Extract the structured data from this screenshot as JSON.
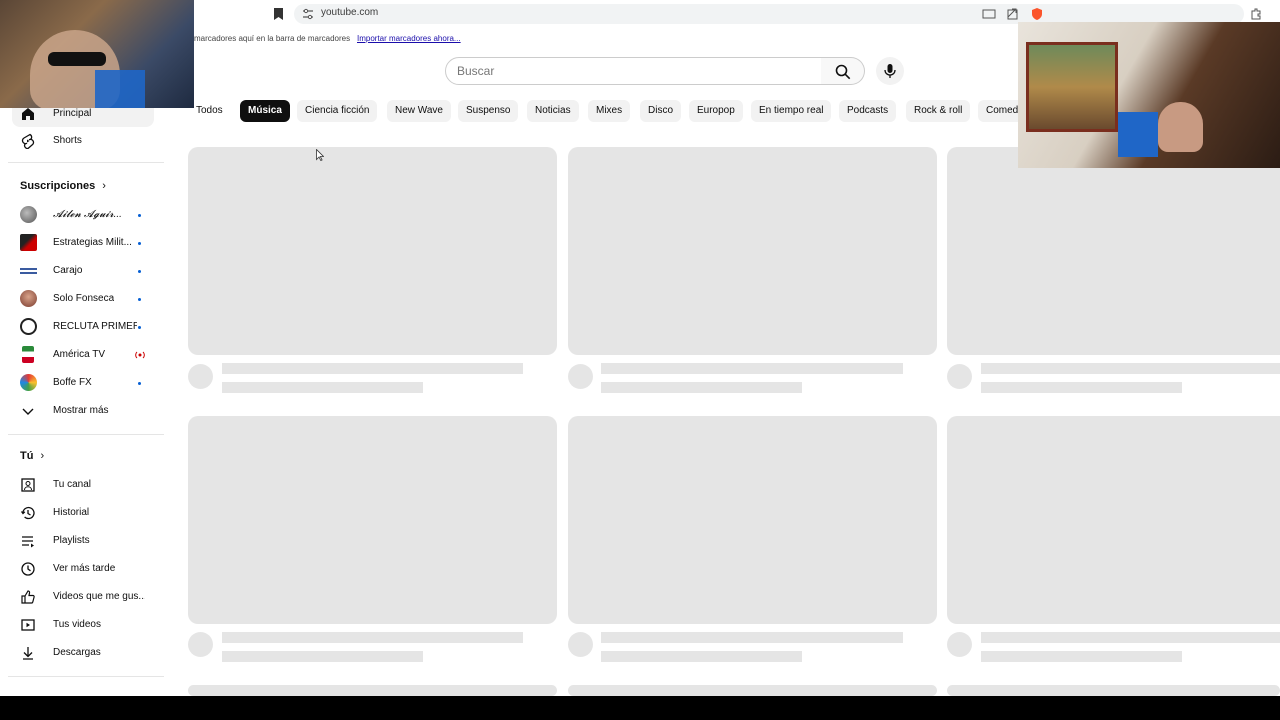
{
  "browser": {
    "url": "youtube.com",
    "bookmarks_hint": "marcadores aquí en la barra de marcadores",
    "import_link": "Importar marcadores ahora..."
  },
  "header": {
    "search_placeholder": "Buscar"
  },
  "chips": [
    "Todos",
    "Música",
    "Ciencia ficción",
    "New Wave",
    "Suspenso",
    "Noticias",
    "Mixes",
    "Disco",
    "Europop",
    "En tiempo real",
    "Podcasts",
    "Rock & roll",
    "Comed"
  ],
  "active_chip": "Música",
  "sidebar": {
    "main": [
      {
        "label": "Principal",
        "icon": "home-icon"
      },
      {
        "label": "Shorts",
        "icon": "shorts-icon"
      }
    ],
    "subscriptions_title": "Suscripciones",
    "subscriptions": [
      {
        "label": "𝓐𝓲𝓵𝓮𝓷 𝓐𝓰𝓾𝓲𝓻...",
        "status": "new"
      },
      {
        "label": "Estrategias Milit...",
        "status": "new"
      },
      {
        "label": "Carajo",
        "status": "new"
      },
      {
        "label": "Solo Fonseca",
        "status": "new"
      },
      {
        "label": "RECLUTA PRIMER",
        "status": "new"
      },
      {
        "label": "América TV",
        "status": "live"
      },
      {
        "label": "Boffe FX",
        "status": "new"
      }
    ],
    "show_more": "Mostrar más",
    "you_title": "Tú",
    "you": [
      {
        "label": "Tu canal",
        "icon": "channel-icon"
      },
      {
        "label": "Historial",
        "icon": "history-icon"
      },
      {
        "label": "Playlists",
        "icon": "playlist-icon"
      },
      {
        "label": "Ver más tarde",
        "icon": "clock-icon"
      },
      {
        "label": "Videos que me gus...",
        "icon": "thumbs-up-icon"
      },
      {
        "label": "Tus videos",
        "icon": "video-icon"
      },
      {
        "label": "Descargas",
        "icon": "download-icon"
      }
    ]
  },
  "colors": {
    "accent": "#0f0f0f",
    "skeleton": "#e5e5e5",
    "live": "#cc0000",
    "new_dot": "#065fd4"
  }
}
